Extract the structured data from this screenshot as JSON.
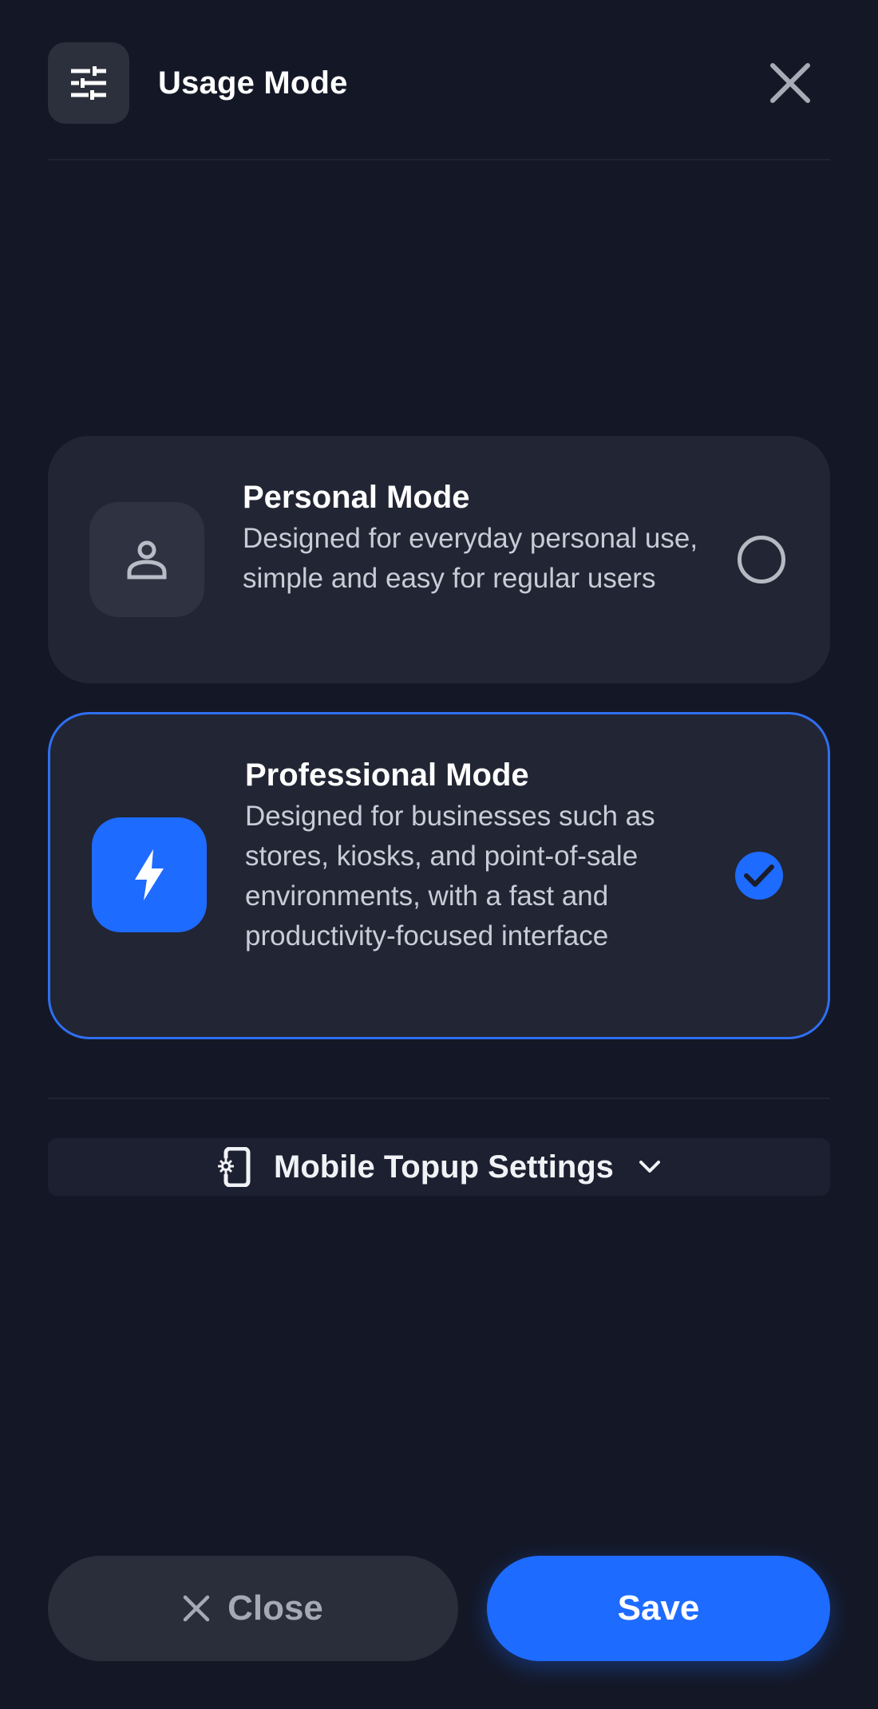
{
  "header": {
    "title": "Usage Mode",
    "icon": "sliders-icon",
    "close_icon": "close-icon"
  },
  "modes": [
    {
      "title": "Personal Mode",
      "description": "Designed for everyday personal use, simple and easy for regular users",
      "icon": "person-icon",
      "selected": false
    },
    {
      "title": "Professional Mode",
      "description": "Designed for businesses such as stores, kiosks, and point-of-sale environments, with a fast and productivity-focused interface",
      "icon": "lightning-icon",
      "selected": true
    }
  ],
  "settings": {
    "label": "Mobile Topup Settings",
    "icon": "phone-settings-icon",
    "chevron": "chevron-down-icon"
  },
  "footer": {
    "close_label": "Close",
    "save_label": "Save"
  },
  "colors": {
    "background": "#141826",
    "card": "#222533",
    "accent": "#1e6bff"
  }
}
